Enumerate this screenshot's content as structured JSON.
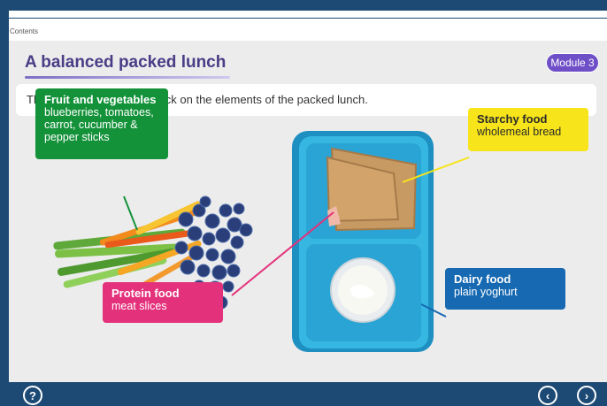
{
  "nav": {
    "contents_label": "Contents"
  },
  "page": {
    "title": "A balanced packed lunch",
    "module_badge": "Module 3",
    "instruction": "This might look like this: Click on the elements of the packed lunch."
  },
  "callouts": {
    "fruit": {
      "title": "Fruit and vegetables",
      "body": "blueberries, tomatoes, carrot, cucumber & pepper sticks",
      "color": "#14923a"
    },
    "starchy": {
      "title": "Starchy food",
      "body": "wholemeal bread",
      "color": "#f7e41a"
    },
    "protein": {
      "title": "Protein food",
      "body": "meat slices",
      "color": "#e4317b"
    },
    "dairy": {
      "title": "Dairy food",
      "body": "plain yoghurt",
      "color": "#1769b2"
    }
  },
  "footer": {
    "help_icon": "?",
    "prev_icon": "‹",
    "next_icon": "›"
  },
  "colors": {
    "frame": "#1c4a75",
    "title": "#4a3c86",
    "badge": "#6f4fc8",
    "lunchbox": "#2fb3dd"
  }
}
